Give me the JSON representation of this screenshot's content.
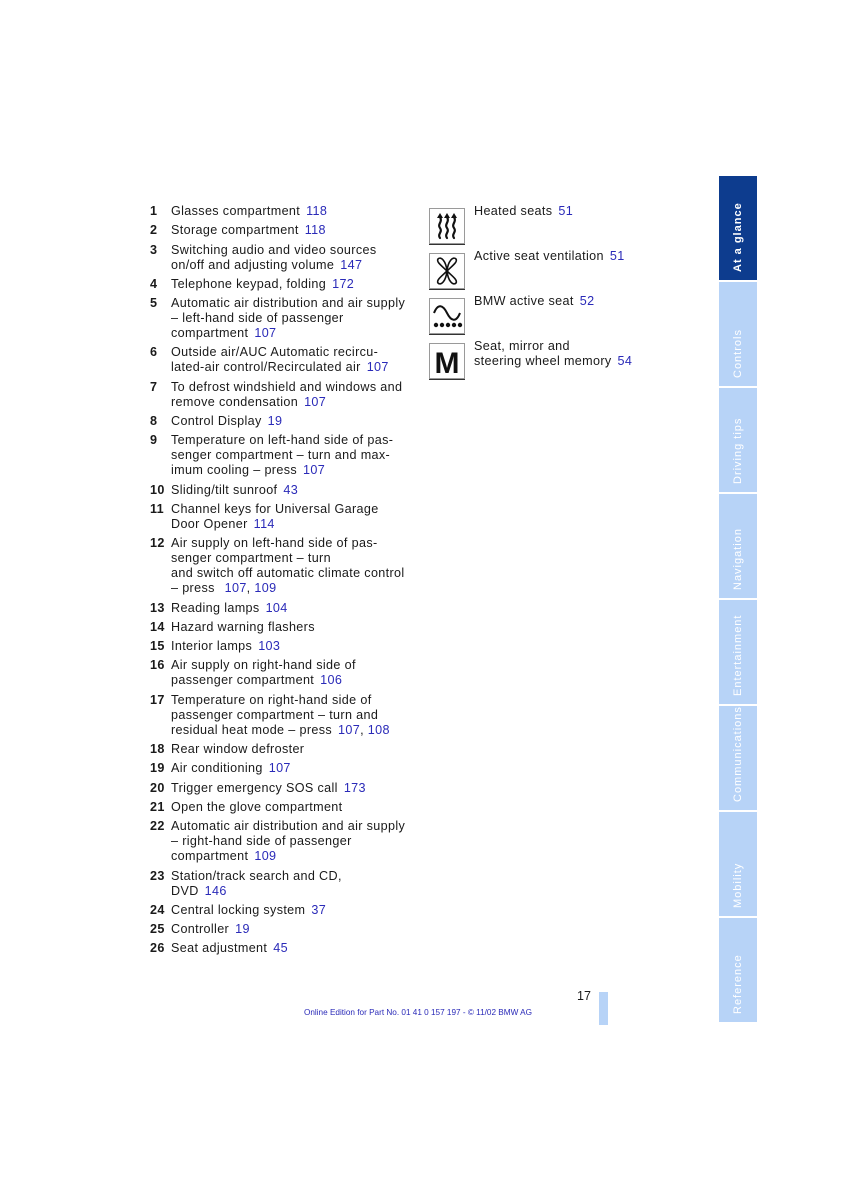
{
  "items": [
    {
      "num": "1",
      "lines": [
        "Glasses compartment"
      ],
      "refs": [
        "118"
      ]
    },
    {
      "num": "2",
      "lines": [
        "Storage compartment"
      ],
      "refs": [
        "118"
      ]
    },
    {
      "num": "3",
      "lines": [
        "Switching audio and video sources",
        "on/off and adjusting volume"
      ],
      "refs": [
        "147"
      ]
    },
    {
      "num": "4",
      "lines": [
        "Telephone keypad, folding"
      ],
      "refs": [
        "172"
      ]
    },
    {
      "num": "5",
      "lines": [
        "Automatic air distribution and air supply",
        "– left-hand side of passenger",
        "compartment"
      ],
      "refs": [
        "107"
      ]
    },
    {
      "num": "6",
      "lines": [
        "Outside air/AUC Automatic recircu-",
        "lated-air control/Recirculated air"
      ],
      "refs": [
        "107"
      ]
    },
    {
      "num": "7",
      "lines": [
        "To defrost windshield and windows and",
        "remove condensation"
      ],
      "refs": [
        "107"
      ]
    },
    {
      "num": "8",
      "lines": [
        "Control Display"
      ],
      "refs": [
        "19"
      ]
    },
    {
      "num": "9",
      "lines": [
        "Temperature on left-hand side of pas-",
        "senger compartment – turn and max-",
        "imum cooling – press"
      ],
      "refs": [
        "107"
      ]
    },
    {
      "num": "10",
      "lines": [
        "Sliding/tilt sunroof"
      ],
      "refs": [
        "43"
      ]
    },
    {
      "num": "11",
      "lines": [
        "Channel keys for Universal Garage",
        "Door Opener"
      ],
      "refs": [
        "114"
      ]
    },
    {
      "num": "12",
      "lines": [
        "Air supply on left-hand side of pas-",
        "senger compartment – turn",
        "and switch off automatic climate control",
        "– press "
      ],
      "refs": [
        "107",
        "109"
      ]
    },
    {
      "num": "13",
      "lines": [
        "Reading lamps"
      ],
      "refs": [
        "104"
      ]
    },
    {
      "num": "14",
      "lines": [
        "Hazard warning flashers"
      ],
      "refs": []
    },
    {
      "num": "15",
      "lines": [
        "Interior lamps"
      ],
      "refs": [
        "103"
      ]
    },
    {
      "num": "16",
      "lines": [
        "Air supply on right-hand side of",
        "passenger compartment"
      ],
      "refs": [
        "106"
      ]
    },
    {
      "num": "17",
      "lines": [
        "Temperature on right-hand side of",
        "passenger compartment – turn and",
        "residual heat mode – press"
      ],
      "refs": [
        "107",
        "108"
      ]
    },
    {
      "num": "18",
      "lines": [
        "Rear window defroster"
      ],
      "refs": []
    },
    {
      "num": "19",
      "lines": [
        "Air conditioning"
      ],
      "refs": [
        "107"
      ]
    },
    {
      "num": "20",
      "lines": [
        "Trigger emergency SOS call"
      ],
      "refs": [
        "173"
      ]
    },
    {
      "num": "21",
      "lines": [
        "Open the glove compartment"
      ],
      "refs": []
    },
    {
      "num": "22",
      "lines": [
        "Automatic air distribution and air supply",
        "– right-hand side of passenger",
        "compartment"
      ],
      "refs": [
        "109"
      ]
    },
    {
      "num": "23",
      "lines": [
        "Station/track search and CD,",
        "DVD"
      ],
      "refs": [
        "146"
      ]
    },
    {
      "num": "24",
      "lines": [
        "Central locking system"
      ],
      "refs": [
        "37"
      ]
    },
    {
      "num": "25",
      "lines": [
        "Controller"
      ],
      "refs": [
        "19"
      ]
    },
    {
      "num": "26",
      "lines": [
        "Seat adjustment"
      ],
      "refs": [
        "45"
      ]
    }
  ],
  "symbols": [
    {
      "icon": "heated-seats-icon",
      "lines": [
        "Heated seats"
      ],
      "ref": "51"
    },
    {
      "icon": "seat-ventilation-fan-icon",
      "lines": [
        "Active seat ventilation"
      ],
      "ref": "51"
    },
    {
      "icon": "active-seat-wave-icon",
      "lines": [
        "BMW active seat"
      ],
      "ref": "52"
    },
    {
      "icon": "memory-m-icon",
      "lines": [
        "Seat, mirror and",
        "steering wheel memory"
      ],
      "ref": "54"
    }
  ],
  "tabs": [
    {
      "label": "At a glance",
      "active": true
    },
    {
      "label": "Controls",
      "active": false
    },
    {
      "label": "Driving tips",
      "active": false
    },
    {
      "label": "Navigation",
      "active": false
    },
    {
      "label": "Entertainment",
      "active": false
    },
    {
      "label": "Communications",
      "active": false
    },
    {
      "label": "Mobility",
      "active": false
    },
    {
      "label": "Reference",
      "active": false
    }
  ],
  "page_number": "17",
  "footer": "Online Edition for Part No. 01 41 0 157 197 - © 11/02 BMW AG",
  "colors": {
    "link": "#2a2ab8",
    "tab_active": "#0d3c8e",
    "tab_inactive": "#b7d3f7"
  }
}
